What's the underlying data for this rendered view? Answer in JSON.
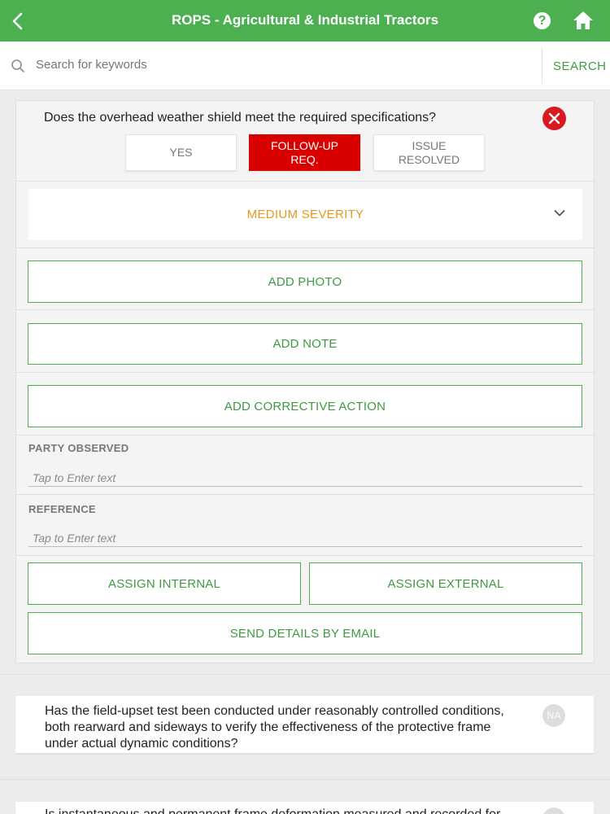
{
  "header": {
    "title": "ROPS - Agricultural & Industrial Tractors",
    "help_label": "?",
    "color_primary": "#4caf50"
  },
  "search": {
    "placeholder": "Search for keywords",
    "button_label": "SEARCH"
  },
  "active_question": {
    "text": "Does the overhead weather shield meet the required specifications?",
    "options": [
      "YES",
      "FOLLOW-UP\nREQ.",
      "ISSUE\nRESOLVED"
    ],
    "selected_option": "FOLLOW-UP REQ.",
    "severity": "MEDIUM SEVERITY",
    "severity_color": "#e5991f",
    "actions": {
      "add_photo": "ADD PHOTO",
      "add_note": "ADD NOTE",
      "add_corrective_action": "ADD CORRECTIVE ACTION",
      "assign_internal": "ASSIGN INTERNAL",
      "assign_external": "ASSIGN EXTERNAL",
      "send_email": "SEND DETAILS BY EMAIL"
    },
    "fields": {
      "party_observed_label": "PARTY OBSERVED",
      "party_observed_placeholder": "Tap to Enter text",
      "reference_label": "REFERENCE",
      "reference_placeholder": "Tap to Enter text"
    }
  },
  "questions": [
    {
      "text": "Has the field-upset test been conducted under reasonably controlled conditions, both rearward and sideways to verify the effectiveness of the protective frame under actual dynamic conditions?",
      "na_label": "NA"
    },
    {
      "text": "Is instantaneous and permanent frame deformation measured and recorded for"
    }
  ]
}
